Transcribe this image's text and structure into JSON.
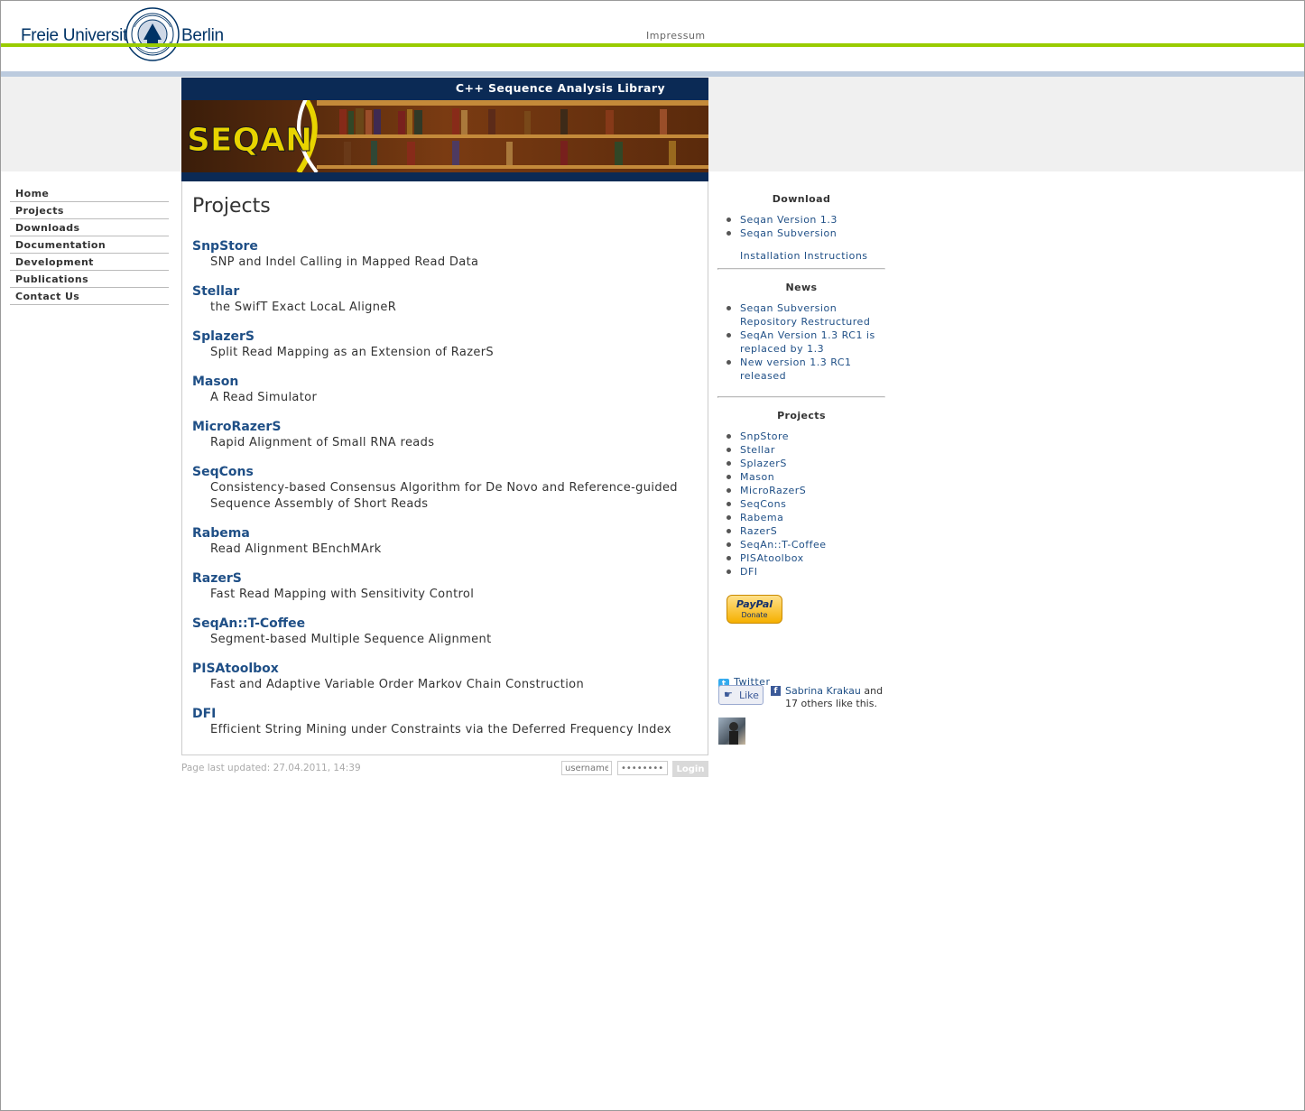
{
  "header": {
    "fu_left": "Freie Universität",
    "fu_right": "Berlin",
    "impressum": "Impressum",
    "banner_title": "C++ Sequence Analysis Library",
    "logo_text": "SEQAN"
  },
  "nav": [
    {
      "label": "Home"
    },
    {
      "label": "Projects"
    },
    {
      "label": "Downloads"
    },
    {
      "label": "Documentation"
    },
    {
      "label": "Development"
    },
    {
      "label": "Publications"
    },
    {
      "label": "Contact Us"
    }
  ],
  "main": {
    "title": "Projects",
    "projects": [
      {
        "name": "SnpStore",
        "desc": "SNP and Indel Calling in Mapped Read Data"
      },
      {
        "name": "Stellar",
        "desc": "the SwifT Exact LocaL AligneR"
      },
      {
        "name": "SplazerS",
        "desc": "Split Read Mapping as an Extension of RazerS"
      },
      {
        "name": "Mason",
        "desc": "A Read Simulator"
      },
      {
        "name": "MicroRazerS",
        "desc": "Rapid Alignment of Small RNA reads"
      },
      {
        "name": "SeqCons",
        "desc": "Consistency-based Consensus Algorithm for De Novo and Reference-guided Sequence Assembly of Short Reads"
      },
      {
        "name": "Rabema",
        "desc": "Read Alignment BEnchMArk"
      },
      {
        "name": "RazerS",
        "desc": "Fast Read Mapping with Sensitivity Control"
      },
      {
        "name": "SeqAn::T-Coffee",
        "desc": "Segment-based Multiple Sequence Alignment"
      },
      {
        "name": "PISAtoolbox",
        "desc": "Fast and Adaptive Variable Order Markov Chain Construction"
      },
      {
        "name": "DFI",
        "desc": "Efficient String Mining under Constraints via the Deferred Frequency Index"
      }
    ]
  },
  "footer": {
    "updated": "Page last updated: 27.04.2011, 14:39",
    "username_placeholder": "username",
    "password_placeholder": "••••••••",
    "login_label": "Login"
  },
  "sidebar": {
    "download_title": "Download",
    "download_links": [
      "Seqan Version 1.3",
      "Seqan Subversion"
    ],
    "install_link": "Installation Instructions",
    "news_title": "News",
    "news_links": [
      "Seqan Subversion Repository Restructured",
      "SeqAn Version 1.3 RC1 is replaced by 1.3",
      "New version 1.3 RC1 released"
    ],
    "projects_title": "Projects",
    "project_links": [
      "SnpStore",
      "Stellar",
      "SplazerS",
      "Mason",
      "MicroRazerS",
      "SeqCons",
      "Rabema",
      "RazerS",
      "SeqAn::T-Coffee",
      "PISAtoolbox",
      "DFI"
    ],
    "paypal_text": "PayPal",
    "paypal_donate": "Donate",
    "twitter_label": "Twitter",
    "like_label": "Like",
    "like_name": "Sabrina Krakau",
    "like_and": "and",
    "like_others": "17 others like this."
  },
  "colors": {
    "brand_green": "#99cc00",
    "brand_navy": "#0b2a55",
    "link_blue": "#1f4f86"
  }
}
